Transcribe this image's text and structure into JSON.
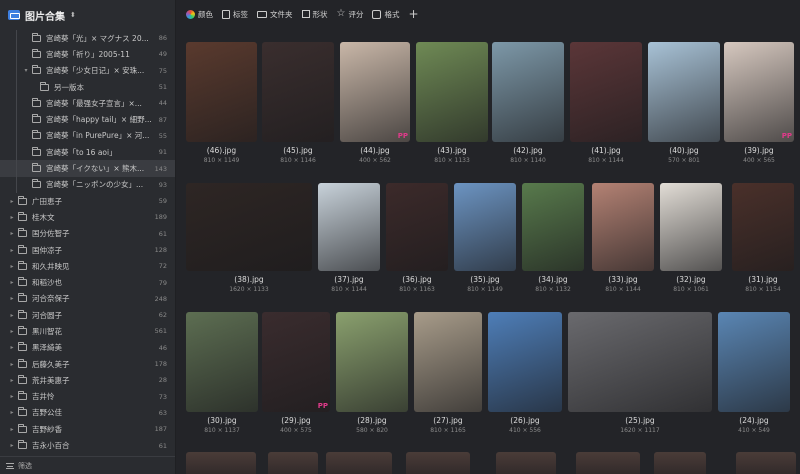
{
  "sidebar": {
    "title": "图片合集",
    "tree": [
      {
        "label": "宫崎葵「光」× マグナス 20...",
        "count": "86",
        "level": 2,
        "arrow": ""
      },
      {
        "label": "宫崎葵「祈り」2005-11",
        "count": "49",
        "level": 2,
        "arrow": ""
      },
      {
        "label": "宫崎葵「少女日记」× 安珠...",
        "count": "75",
        "level": 2,
        "arrow": "v"
      },
      {
        "label": "另一版本",
        "count": "51",
        "level": 3,
        "arrow": ""
      },
      {
        "label": "宫崎葵「最强女子宣言」×...",
        "count": "44",
        "level": 2,
        "arrow": ""
      },
      {
        "label": "宫崎葵「happy tail」× 細野...",
        "count": "87",
        "level": 2,
        "arrow": ""
      },
      {
        "label": "宫崎葵「in PurePure」× 河...",
        "count": "55",
        "level": 2,
        "arrow": ""
      },
      {
        "label": "宫崎葵「to 16 aoi」",
        "count": "91",
        "level": 2,
        "arrow": ""
      },
      {
        "label": "宫崎葵「イクない」× 熊木...",
        "count": "143",
        "level": 2,
        "arrow": "",
        "selected": true
      },
      {
        "label": "宫崎葵「ニッポンの少女」...",
        "count": "93",
        "level": 2,
        "arrow": ""
      },
      {
        "label": "广田恵子",
        "count": "59",
        "level": 1,
        "arrow": ">"
      },
      {
        "label": "桂木文",
        "count": "189",
        "level": 1,
        "arrow": ">"
      },
      {
        "label": "国分佐智子",
        "count": "61",
        "level": 1,
        "arrow": ">"
      },
      {
        "label": "国仲凉子",
        "count": "128",
        "level": 1,
        "arrow": ">"
      },
      {
        "label": "和久井映见",
        "count": "72",
        "level": 1,
        "arrow": ">"
      },
      {
        "label": "和稻沙也",
        "count": "79",
        "level": 1,
        "arrow": ">"
      },
      {
        "label": "河合奈保子",
        "count": "248",
        "level": 1,
        "arrow": ">"
      },
      {
        "label": "河合圆子",
        "count": "62",
        "level": 1,
        "arrow": ">"
      },
      {
        "label": "黑川智花",
        "count": "561",
        "level": 1,
        "arrow": ">"
      },
      {
        "label": "黑泽綺美",
        "count": "46",
        "level": 1,
        "arrow": ">"
      },
      {
        "label": "后藤久美子",
        "count": "178",
        "level": 1,
        "arrow": ">"
      },
      {
        "label": "荒井美惠子",
        "count": "28",
        "level": 1,
        "arrow": ">"
      },
      {
        "label": "吉井怜",
        "count": "73",
        "level": 1,
        "arrow": ">"
      },
      {
        "label": "吉野公佳",
        "count": "63",
        "level": 1,
        "arrow": ">"
      },
      {
        "label": "吉野紗香",
        "count": "187",
        "level": 1,
        "arrow": ">"
      },
      {
        "label": "吉永小百合",
        "count": "61",
        "level": 1,
        "arrow": ">"
      }
    ],
    "footer": "筛选"
  },
  "toolbar": {
    "items": [
      {
        "label": "颜色",
        "icon": "color-wheel-icon"
      },
      {
        "label": "标签",
        "icon": "tag-icon"
      },
      {
        "label": "文件夹",
        "icon": "folder-icon"
      },
      {
        "label": "形状",
        "icon": "shape-icon"
      },
      {
        "label": "评分",
        "icon": "star-icon"
      },
      {
        "label": "格式",
        "icon": "format-icon"
      }
    ],
    "add_label": "+"
  },
  "images": [
    {
      "row": 0,
      "name": "(46).jpg",
      "size": "810 × 1149",
      "bg": "#5a3a2e",
      "pp": false
    },
    {
      "row": 0,
      "name": "(45).jpg",
      "size": "810 × 1146",
      "bg": "#3a2e2e",
      "pp": false
    },
    {
      "row": 0,
      "name": "(44).jpg",
      "size": "400 × 562",
      "bg": "#c9b7a8",
      "pp": true
    },
    {
      "row": 0,
      "name": "(43).jpg",
      "size": "810 × 1133",
      "bg": "#6f8a55",
      "pp": false
    },
    {
      "row": 0,
      "name": "(42).jpg",
      "size": "810 × 1140",
      "bg": "#7d98a8",
      "pp": false
    },
    {
      "row": 0,
      "name": "(41).jpg",
      "size": "810 × 1144",
      "bg": "#5b3638",
      "pp": false
    },
    {
      "row": 0,
      "name": "(40).jpg",
      "size": "570 × 801",
      "bg": "#a8c2d6",
      "pp": false
    },
    {
      "row": 0,
      "name": "(39).jpg",
      "size": "400 × 565",
      "bg": "#d6c8bf",
      "pp": true
    },
    {
      "row": 1,
      "name": "(38).jpg",
      "size": "1620 × 1133",
      "bg": "#2e2624",
      "pp": false
    },
    {
      "row": 1,
      "name": "(37).jpg",
      "size": "810 × 1144",
      "bg": "#c8d2da",
      "pp": false
    },
    {
      "row": 1,
      "name": "(36).jpg",
      "size": "810 × 1163",
      "bg": "#3c2a2a",
      "pp": false
    },
    {
      "row": 1,
      "name": "(35).jpg",
      "size": "810 × 1149",
      "bg": "#6c94c2",
      "pp": false
    },
    {
      "row": 1,
      "name": "(34).jpg",
      "size": "810 × 1132",
      "bg": "#587a4c",
      "pp": false
    },
    {
      "row": 1,
      "name": "(33).jpg",
      "size": "810 × 1144",
      "bg": "#b48274",
      "pp": false
    },
    {
      "row": 1,
      "name": "(32).jpg",
      "size": "810 × 1061",
      "bg": "#e2ddd6",
      "pp": false
    },
    {
      "row": 1,
      "name": "(31).jpg",
      "size": "810 × 1154",
      "bg": "#4a302a",
      "pp": false
    },
    {
      "row": 2,
      "name": "(30).jpg",
      "size": "810 × 1137",
      "bg": "#5d6e52",
      "pp": false
    },
    {
      "row": 2,
      "name": "(29).jpg",
      "size": "400 × 575",
      "bg": "#3a2c2e",
      "pp": true
    },
    {
      "row": 2,
      "name": "(28).jpg",
      "size": "580 × 820",
      "bg": "#8aa06e",
      "pp": false
    },
    {
      "row": 2,
      "name": "(27).jpg",
      "size": "810 × 1165",
      "bg": "#a89c8a",
      "pp": false
    },
    {
      "row": 2,
      "name": "(26).jpg",
      "size": "410 × 556",
      "bg": "#4e7eb8",
      "pp": false
    },
    {
      "row": 2,
      "name": "(25).jpg",
      "size": "1620 × 1117",
      "bg": "#6a6a6e",
      "pp": false
    },
    {
      "row": 2,
      "name": "(24).jpg",
      "size": "410 × 549",
      "bg": "#5a86b4",
      "pp": false
    }
  ]
}
